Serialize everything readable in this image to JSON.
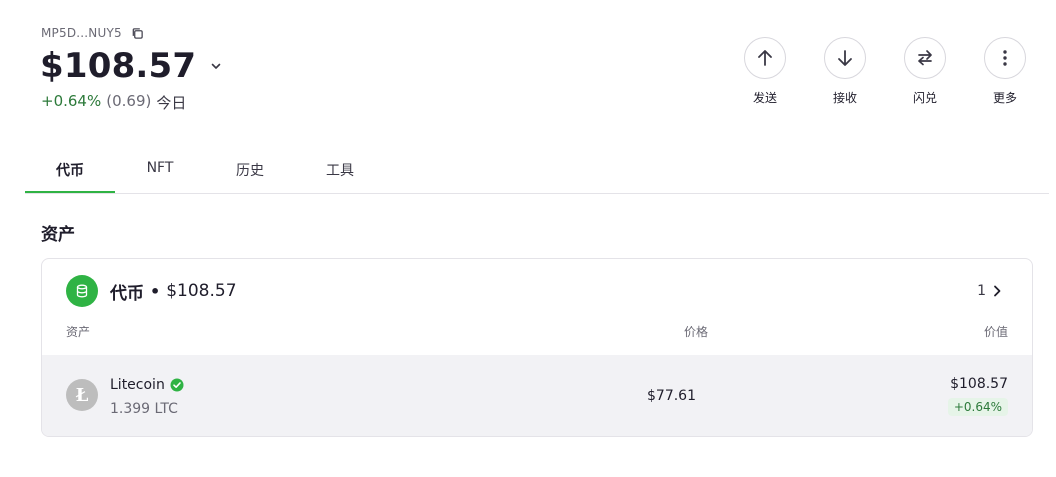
{
  "wallet": {
    "address": "MP5D...NUY5",
    "balance": "$108.57",
    "change_pct": "+0.64%",
    "change_abs": "(0.69)",
    "change_period": "今日"
  },
  "actions": [
    {
      "label": "发送",
      "icon": "arrow-up-icon"
    },
    {
      "label": "接收",
      "icon": "arrow-down-icon"
    },
    {
      "label": "闪兑",
      "icon": "swap-icon"
    },
    {
      "label": "更多",
      "icon": "more-vertical-icon"
    }
  ],
  "tabs": [
    {
      "label": "代币",
      "active": true
    },
    {
      "label": "NFT",
      "active": false
    },
    {
      "label": "历史",
      "active": false
    },
    {
      "label": "工具",
      "active": false
    }
  ],
  "assets": {
    "section_title": "资产",
    "card": {
      "title": "代币",
      "separator": "•",
      "amount": "$108.57",
      "count": "1"
    },
    "columns": {
      "asset": "资产",
      "price": "价格",
      "value": "价值"
    },
    "rows": [
      {
        "name": "Litecoin",
        "balance": "1.399 LTC",
        "price": "$77.61",
        "value": "$108.57",
        "change": "+0.64%",
        "logo_letter": "Ł"
      }
    ]
  },
  "colors": {
    "accent_green": "#2fb344",
    "positive_text": "#2c7a3a",
    "row_bg": "#f2f2f5"
  }
}
